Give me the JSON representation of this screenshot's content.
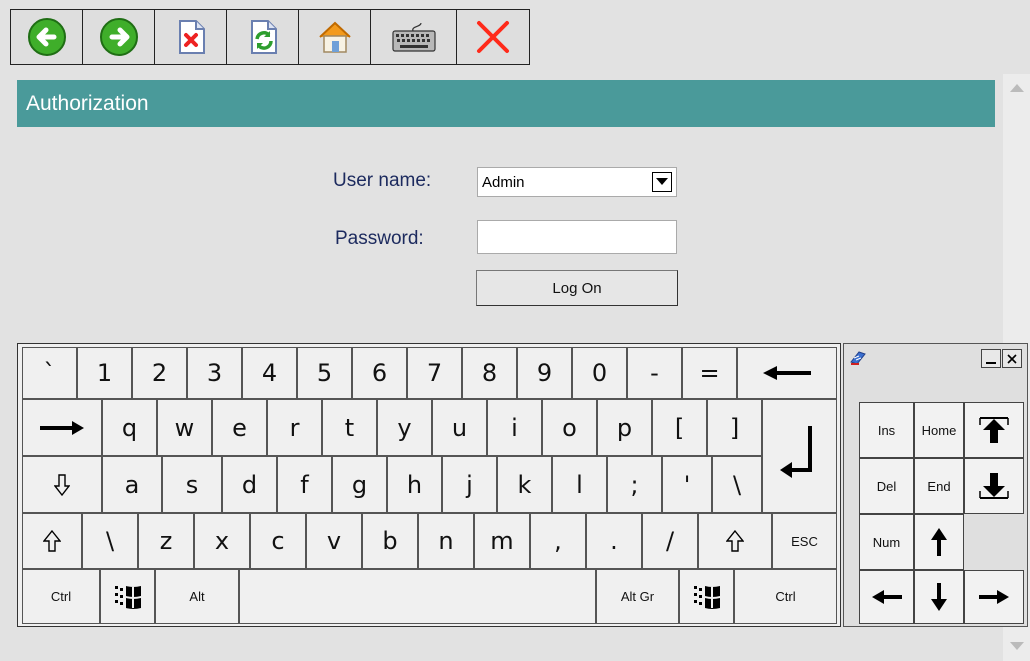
{
  "toolbar": {
    "buttons": [
      {
        "name": "back-button",
        "icon": "arrow-left-green-icon"
      },
      {
        "name": "forward-button",
        "icon": "arrow-right-green-icon"
      },
      {
        "name": "stop-button",
        "icon": "document-x-icon"
      },
      {
        "name": "refresh-button",
        "icon": "document-refresh-icon"
      },
      {
        "name": "home-button",
        "icon": "home-icon"
      },
      {
        "name": "keyboard-button",
        "icon": "keyboard-icon"
      },
      {
        "name": "close-button",
        "icon": "close-x-red-icon"
      }
    ]
  },
  "header": {
    "title": "Authorization"
  },
  "login": {
    "user_label": "User name:",
    "user_value": "Admin",
    "password_label": "Password:",
    "password_value": "",
    "logon_label": "Log On"
  },
  "keyboard": {
    "row1": [
      "`",
      "1",
      "2",
      "3",
      "4",
      "5",
      "6",
      "7",
      "8",
      "9",
      "0",
      "-",
      "="
    ],
    "row2": [
      "q",
      "w",
      "e",
      "r",
      "t",
      "y",
      "u",
      "i",
      "o",
      "p",
      "[",
      "]"
    ],
    "row3": [
      "a",
      "s",
      "d",
      "f",
      "g",
      "h",
      "j",
      "k",
      "l",
      ";",
      "'",
      "\\"
    ],
    "row4": [
      "\\",
      "z",
      "x",
      "c",
      "v",
      "b",
      "n",
      "m",
      ",",
      ".",
      "/"
    ],
    "esc": "ESC",
    "ctrl_left": "Ctrl",
    "alt": "Alt",
    "altgr": "Alt Gr",
    "ctrl_right": "Ctrl"
  },
  "numpad": {
    "ins": "Ins",
    "home": "Home",
    "del": "Del",
    "end": "End",
    "num": "Num"
  },
  "colors": {
    "header_bg": "#4a9a9a",
    "label_text": "#1c2a5e",
    "background": "#e2e2e2"
  }
}
